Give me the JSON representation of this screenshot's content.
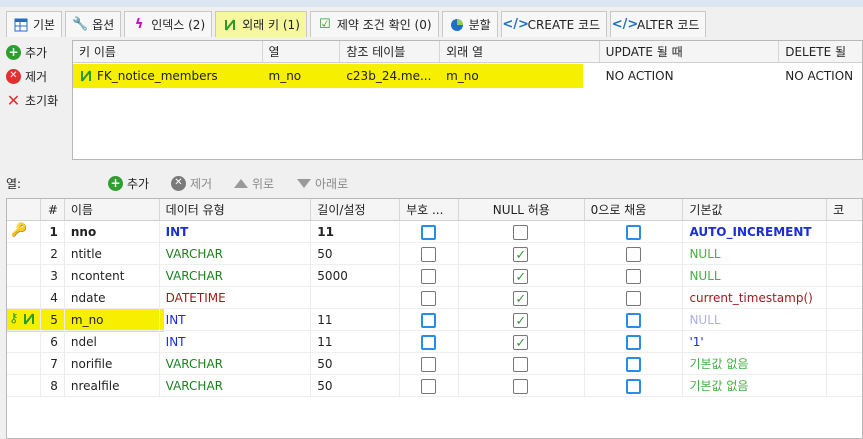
{
  "tabs": [
    {
      "label": "기본",
      "icon": "table-icon",
      "color": "#1f6fc5"
    },
    {
      "label": "옵션",
      "icon": "wrench-icon",
      "color": "#4a5a8a"
    },
    {
      "label": "인덱스 (2)",
      "icon": "lightning-icon",
      "color": "#c800c8"
    },
    {
      "label": "외래 키 (1)",
      "icon": "foreign-key-icon",
      "color": "#2a9a2a",
      "active": true
    },
    {
      "label": "제약 조건 확인 (0)",
      "icon": "check-icon",
      "color": "#2a9a2a"
    },
    {
      "label": "분할",
      "icon": "pie-icon",
      "color": "#1f6fc5"
    },
    {
      "label": "CREATE 코드",
      "icon": "code-icon",
      "color": "#1f6fc5"
    },
    {
      "label": "ALTER 코드",
      "icon": "code-icon",
      "color": "#1f6fc5"
    }
  ],
  "fk_side": {
    "add": "추가",
    "remove": "제거",
    "reset": "초기화"
  },
  "fk_grid": {
    "headers": [
      "키 이름",
      "열",
      "참조 테이블",
      "외래 열",
      "UPDATE 될 때",
      "DELETE 될"
    ],
    "rows": [
      {
        "key_name": "FK_notice_members",
        "column": "m_no",
        "ref_table": "c23b_24.me...",
        "foreign_column": "m_no",
        "on_update": "NO ACTION",
        "on_delete": "NO ACTION"
      }
    ]
  },
  "columns_toolbar": {
    "label": "열:",
    "add": "추가",
    "remove": "제거",
    "up": "위로",
    "down": "아래로"
  },
  "grid": {
    "headers": [
      "#",
      "이름",
      "데이터 유형",
      "길이/설정",
      "부호 ...",
      "NULL 허용",
      "0으로 채움",
      "기본값",
      "코"
    ],
    "rows": [
      {
        "num": "1",
        "name": "nno",
        "type": "INT",
        "length": "11",
        "unsigned": false,
        "allow_null": false,
        "zerofill": false,
        "default": "AUTO_INCREMENT",
        "key": "primary"
      },
      {
        "num": "2",
        "name": "ntitle",
        "type": "VARCHAR",
        "length": "50",
        "unsigned": false,
        "allow_null": true,
        "zerofill": false,
        "default": "NULL",
        "key": ""
      },
      {
        "num": "3",
        "name": "ncontent",
        "type": "VARCHAR",
        "length": "5000",
        "unsigned": false,
        "allow_null": true,
        "zerofill": false,
        "default": "NULL",
        "key": ""
      },
      {
        "num": "4",
        "name": "ndate",
        "type": "DATETIME",
        "length": "",
        "unsigned": false,
        "allow_null": true,
        "zerofill": false,
        "default": "current_timestamp()",
        "key": ""
      },
      {
        "num": "5",
        "name": "m_no",
        "type": "INT",
        "length": "11",
        "unsigned": false,
        "allow_null": true,
        "zerofill": false,
        "default": "NULL",
        "key": "foreign"
      },
      {
        "num": "6",
        "name": "ndel",
        "type": "INT",
        "length": "11",
        "unsigned": false,
        "allow_null": true,
        "zerofill": false,
        "default": "'1'",
        "key": ""
      },
      {
        "num": "7",
        "name": "norifile",
        "type": "VARCHAR",
        "length": "50",
        "unsigned": false,
        "allow_null": false,
        "zerofill": false,
        "default": "기본값 없음",
        "key": ""
      },
      {
        "num": "8",
        "name": "nrealfile",
        "type": "VARCHAR",
        "length": "50",
        "unsigned": false,
        "allow_null": false,
        "zerofill": false,
        "default": "기본값 없음",
        "key": ""
      }
    ]
  },
  "colors": {
    "highlight": "#f6f000",
    "int_type": "#1a2fd4",
    "varchar_type": "#208020",
    "datetime_type": "#9b1c1c",
    "auto_increment": "#1a2fd4",
    "null_default": "#44b044",
    "null_default_int": "#b0b0e0",
    "timestamp_default": "#9b1c1c",
    "quoted_default": "#1a2fd4",
    "no_default": "#44b044"
  }
}
